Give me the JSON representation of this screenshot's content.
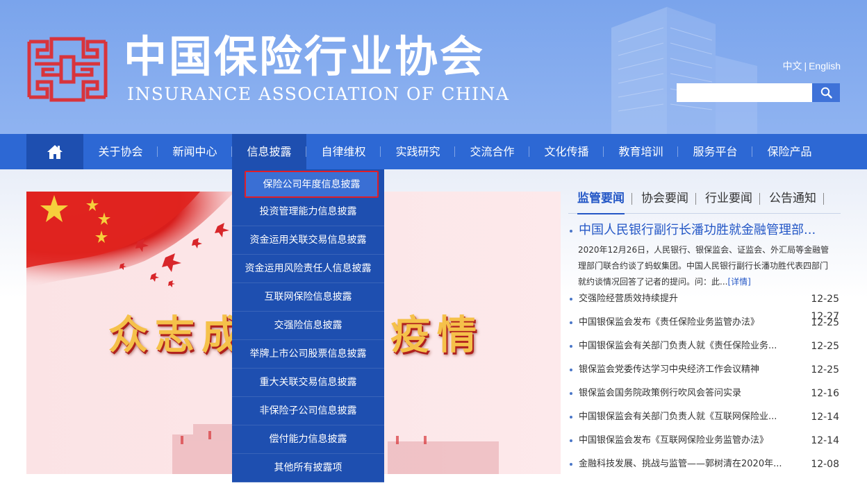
{
  "header": {
    "title_cn": "中国保险行业协会",
    "title_en": "INSURANCE ASSOCIATION OF CHINA",
    "lang": {
      "chinese": "中文",
      "separator": "|",
      "english": "English"
    },
    "search": {
      "placeholder": "",
      "icon": "search-icon"
    }
  },
  "nav": {
    "home_icon": "home-icon",
    "items": [
      {
        "label": "关于协会"
      },
      {
        "label": "新闻中心"
      },
      {
        "label": "信息披露"
      },
      {
        "label": "自律维权"
      },
      {
        "label": "实践研究"
      },
      {
        "label": "交流合作"
      },
      {
        "label": "文化传播"
      },
      {
        "label": "教育培训"
      },
      {
        "label": "服务平台"
      },
      {
        "label": "保险产品"
      }
    ],
    "active_index": 2
  },
  "dropdown": {
    "highlighted": "保险公司年度信息披露",
    "items": [
      "投资管理能力信息披露",
      "资金运用关联交易信息披露",
      "资金运用风险责任人信息披露",
      "互联网保险信息披露",
      "交强险信息披露",
      "举牌上市公司股票信息披露",
      "重大关联交易信息披露",
      "非保险子公司信息披露",
      "偿付能力信息披露",
      "其他所有披露项"
    ]
  },
  "banner": {
    "slogan_left": "众志成",
    "slogan_right": "疫情"
  },
  "news": {
    "tabs": [
      "监管要闻",
      "协会要闻",
      "行业要闻",
      "公告通知"
    ],
    "active_tab": 0,
    "headline": {
      "title": "中国人民银行副行长潘功胜就金融管理部...",
      "summary": "2020年12月26日，人民银行、银保监会、证监会、外汇局等金融管理部门联合约谈了蚂蚁集团。中国人民银行副行长潘功胜代表四部门就约谈情况回答了记者的提问。问：此...",
      "more": "[详情]",
      "date": "12-27"
    },
    "items": [
      {
        "title": "交强险经营质效持续提升",
        "date": "12-25"
      },
      {
        "title": "中国银保监会发布《责任保险业务监管办法》",
        "date": "12-25"
      },
      {
        "title": "中国银保监会有关部门负责人就《责任保险业务...",
        "date": "12-25"
      },
      {
        "title": "银保监会党委传达学习中央经济工作会议精神",
        "date": "12-25"
      },
      {
        "title": "银保监会国务院政策例行吹风会答问实录",
        "date": "12-16"
      },
      {
        "title": "中国银保监会有关部门负责人就《互联网保险业...",
        "date": "12-14"
      },
      {
        "title": "中国银保监会发布《互联网保险业务监管办法》",
        "date": "12-14"
      },
      {
        "title": "金融科技发展、挑战与监管——郭树清在2020年...",
        "date": "12-08"
      }
    ]
  },
  "colors": {
    "header_bg": "#7aa4ec",
    "nav_bg": "#2d68d4",
    "nav_active": "#1e4fb0",
    "accent_blue": "#2457c6",
    "logo_red": "#d8343c",
    "highlight_border": "#e11d27"
  }
}
